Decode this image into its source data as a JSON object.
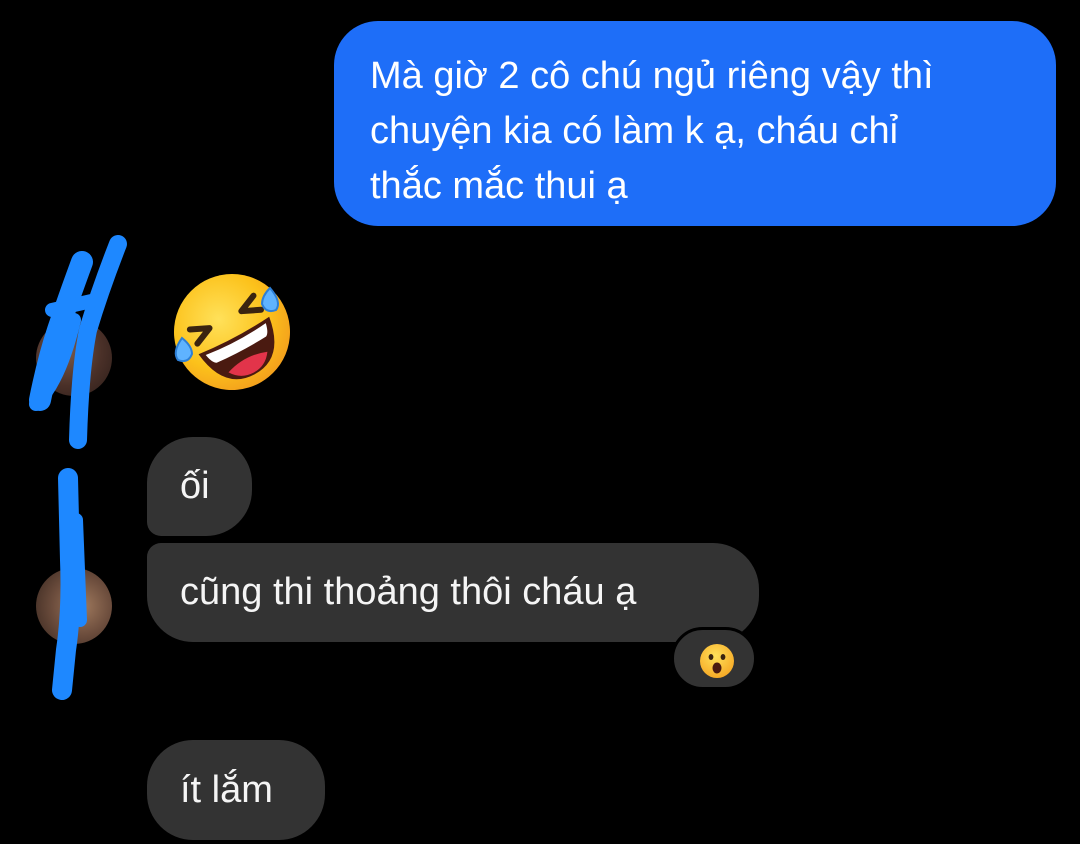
{
  "conversation": {
    "outgoing": {
      "lines": [
        "Mà giờ 2 cô chú ngủ riêng vậy thì",
        "chuyện kia có làm k ạ, cháu chỉ",
        "thắc mắc thui ạ"
      ]
    },
    "incoming": {
      "reaction_emoji": "rolling-on-floor-laughing-emoji",
      "message_1": "ối",
      "message_2": "cũng thi thoảng thôi cháu ạ",
      "message_2_reaction": "astonished-face-emoji",
      "message_3": "ít lắm"
    }
  },
  "colors": {
    "background": "#000000",
    "outgoing_bubble": "#1e6ef8",
    "incoming_bubble": "#333333",
    "redaction_scribble": "#1e88ff"
  }
}
